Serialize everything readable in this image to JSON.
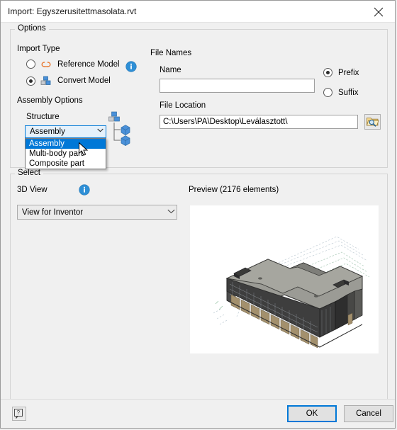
{
  "window": {
    "title": "Import: Egyszerusitettmasolata.rvt",
    "close_icon": "close-icon"
  },
  "options": {
    "legend": "Options",
    "import_type": {
      "label": "Import Type",
      "info_icon": "info-icon",
      "radios": [
        {
          "label": "Reference Model",
          "checked": false,
          "icon": "link-chain-icon"
        },
        {
          "label": "Convert Model",
          "checked": true,
          "icon": "blocks-icon"
        }
      ]
    },
    "assembly_options": {
      "label": "Assembly Options",
      "structure": {
        "label": "Structure",
        "value": "Assembly",
        "open": true,
        "items": [
          "Assembly",
          "Multi-body part",
          "Composite part"
        ],
        "selected_index": 0
      },
      "tree_icon": "assembly-tree-icon"
    },
    "file_names": {
      "label": "File Names",
      "name": {
        "label": "Name",
        "value": "",
        "placeholder": ""
      },
      "affix": {
        "options": [
          {
            "label": "Prefix",
            "checked": true
          },
          {
            "label": "Suffix",
            "checked": false
          }
        ]
      },
      "file_location": {
        "label": "File Location",
        "value": "C:\\Users\\PA\\Desktop\\Leválasztott\\",
        "browse_icon": "folder-browse-icon"
      }
    }
  },
  "select": {
    "legend": "Select",
    "view3d": {
      "label": "3D View",
      "info_icon": "info-icon",
      "value": "View for Inventor"
    },
    "preview": {
      "label": "Preview (2176 elements)",
      "image_alt": "isometric-building-model"
    }
  },
  "footer": {
    "help_label": "?",
    "ok_label": "OK",
    "cancel_label": "Cancel"
  },
  "colors": {
    "accent": "#0078d7",
    "dialog_bg": "#f0f0f0",
    "info_blue": "#2e8fd6",
    "link_orange": "#e8772e"
  }
}
